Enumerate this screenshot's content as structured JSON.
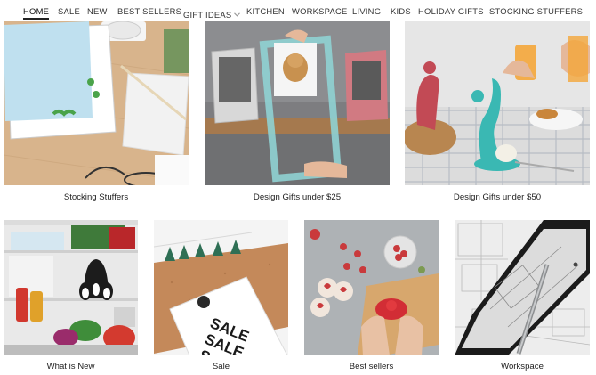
{
  "nav": {
    "items": [
      {
        "label": "HOME",
        "active": true
      },
      {
        "label": "SALE"
      },
      {
        "label": "NEW"
      },
      {
        "label": "BEST SELLERS"
      },
      {
        "label": "GIFT IDEAS",
        "has_dropdown": true
      },
      {
        "label": "KITCHEN"
      },
      {
        "label": "WORKSPACE"
      },
      {
        "label": "LIVING"
      },
      {
        "label": "KIDS"
      },
      {
        "label": "HOLIDAY GIFTS"
      },
      {
        "label": "STOCKING STUFFERS"
      }
    ]
  },
  "tiles": [
    {
      "caption": "Stocking Stuffers"
    },
    {
      "caption": "Design Gifts under $25"
    },
    {
      "caption": "Design Gifts under $50"
    },
    {
      "caption": "What is New"
    },
    {
      "caption": "Sale"
    },
    {
      "caption": "Best sellers"
    },
    {
      "caption": "Workspace"
    }
  ],
  "sale_card": {
    "text": "SALE"
  },
  "colors": {
    "accent": "#7cc7c4",
    "text": "#222222",
    "wood": "#d8b48c",
    "cork": "#c4895a"
  }
}
